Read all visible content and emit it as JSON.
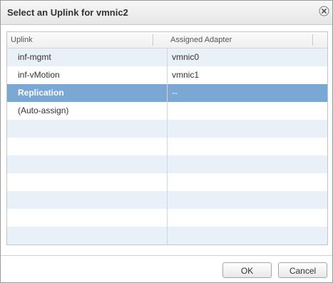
{
  "dialog": {
    "title": "Select an Uplink for vmnic2",
    "close_icon": "close-circle-icon"
  },
  "grid": {
    "columns": [
      "Uplink",
      "Assigned Adapter"
    ],
    "rows": [
      {
        "uplink": "inf-mgmt",
        "adapter": "vmnic0",
        "selected": false
      },
      {
        "uplink": "inf-vMotion",
        "adapter": "vmnic1",
        "selected": false
      },
      {
        "uplink": "Replication",
        "adapter": "--",
        "selected": true
      },
      {
        "uplink": "(Auto-assign)",
        "adapter": "",
        "selected": false
      }
    ],
    "empty_row_count": 7,
    "selection_color": "#7aa7d3",
    "alt_row_color": "#e9f0f8"
  },
  "buttons": {
    "ok": "OK",
    "cancel": "Cancel"
  }
}
